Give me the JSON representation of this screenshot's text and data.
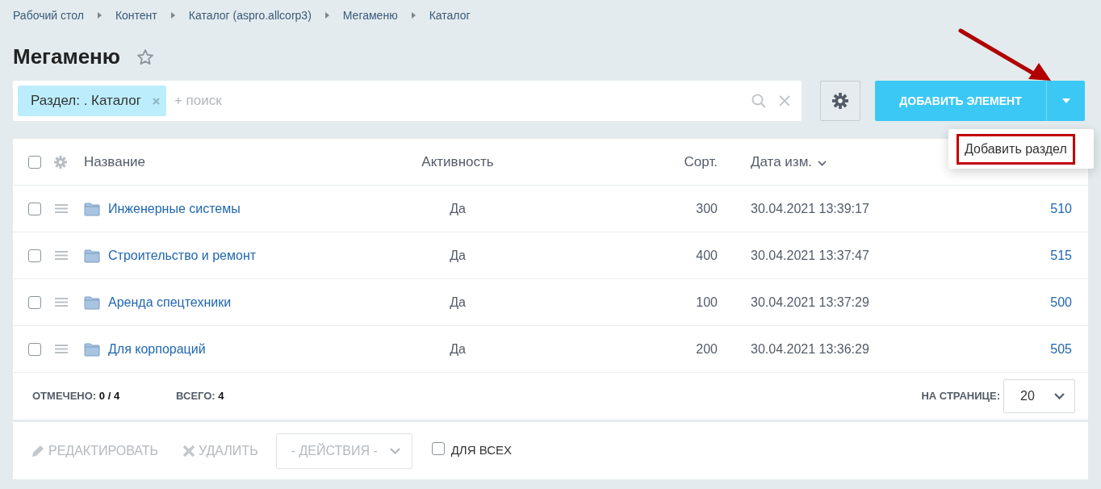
{
  "breadcrumbs": [
    "Рабочий стол",
    "Контент",
    "Каталог (aspro.allcorp3)",
    "Мегаменю",
    "Каталог"
  ],
  "title": "Мегаменю",
  "favorite": false,
  "filter": {
    "tag": "Раздел: . Каталог",
    "placeholder": "+ поиск"
  },
  "add_button": {
    "label": "ДОБАВИТЬ ЭЛЕМЕНТ"
  },
  "dropdown_menu": {
    "items": [
      {
        "label": "Добавить раздел",
        "highlighted": true
      }
    ]
  },
  "table": {
    "select_all_checked": false,
    "columns": [
      "Название",
      "Активность",
      "Сорт.",
      "Дата изм."
    ],
    "rows": [
      {
        "checked": false,
        "name": "Инженерные системы",
        "active": "Да",
        "sort": "300",
        "date": "30.04.2021 13:39:17",
        "id": "510"
      },
      {
        "checked": false,
        "name": "Строительство и ремонт",
        "active": "Да",
        "sort": "400",
        "date": "30.04.2021 13:37:47",
        "id": "515"
      },
      {
        "checked": false,
        "name": "Аренда спецтехники",
        "active": "Да",
        "sort": "100",
        "date": "30.04.2021 13:37:29",
        "id": "500"
      },
      {
        "checked": false,
        "name": "Для корпораций",
        "active": "Да",
        "sort": "200",
        "date": "30.04.2021 13:36:29",
        "id": "505"
      }
    ]
  },
  "footer": {
    "selected_label": "ОТМЕЧЕНО:",
    "selected_value": "0 / 4",
    "total_label": "ВСЕГО:",
    "total_value": "4",
    "per_page_label": "НА СТРАНИЦЕ:",
    "per_page": "20"
  },
  "actions": {
    "edit": "РЕДАКТИРОВАТЬ",
    "delete": "УДАЛИТЬ",
    "select": "- ДЕЙСТВИЯ -",
    "for_all": "ДЛЯ ВСЕХ",
    "for_all_checked": false
  }
}
